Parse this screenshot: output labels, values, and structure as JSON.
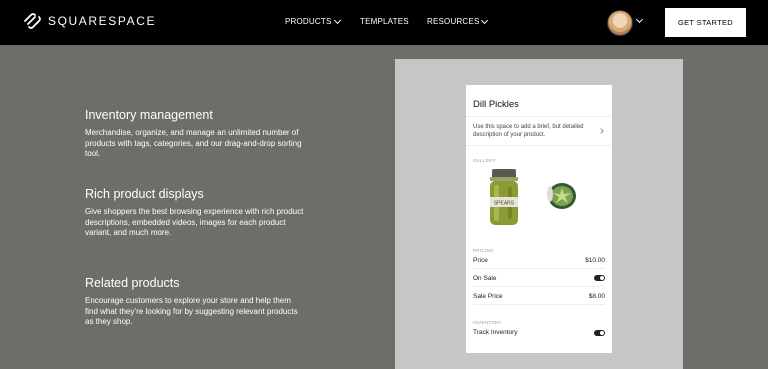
{
  "nav": {
    "logo_text": "SQUARESPACE",
    "items": [
      {
        "label": "PRODUCTS",
        "has_dropdown": true
      },
      {
        "label": "TEMPLATES",
        "has_dropdown": false
      },
      {
        "label": "RESOURCES",
        "has_dropdown": true
      }
    ],
    "cta_label": "GET STARTED"
  },
  "features": [
    {
      "title": "Inventory management",
      "body": "Merchandise, organize, and manage an unlimited number of products with tags, categories, and our drag-and-drop sorting tool."
    },
    {
      "title": "Rich product displays",
      "body": "Give shoppers the best browsing experience with rich product descriptions, embedded videos, images for each product variant, and much more."
    },
    {
      "title": "Related products",
      "body": "Encourage customers to explore your store and help them find what they’re looking for by suggesting relevant products as they shop."
    }
  ],
  "product_card": {
    "title": "Dill Pickles",
    "description": "Use this space to add a brief, but detailed description of your product.",
    "gallery_label": "GALLERY",
    "jar_label": "SPEARS",
    "pricing_label": "PRICING",
    "price_label": "Price",
    "price_value": "$10.00",
    "on_sale_label": "On Sale",
    "on_sale": true,
    "sale_price_label": "Sale Price",
    "sale_price_value": "$8.00",
    "inventory_label": "INVENTORY",
    "track_inventory_label": "Track Inventory",
    "track_inventory": true
  },
  "colors": {
    "page_bg": "#6c6e6a",
    "nav_bg": "#000000",
    "panel_bg": "#c6c6c6",
    "toggle_on": "#222222"
  }
}
